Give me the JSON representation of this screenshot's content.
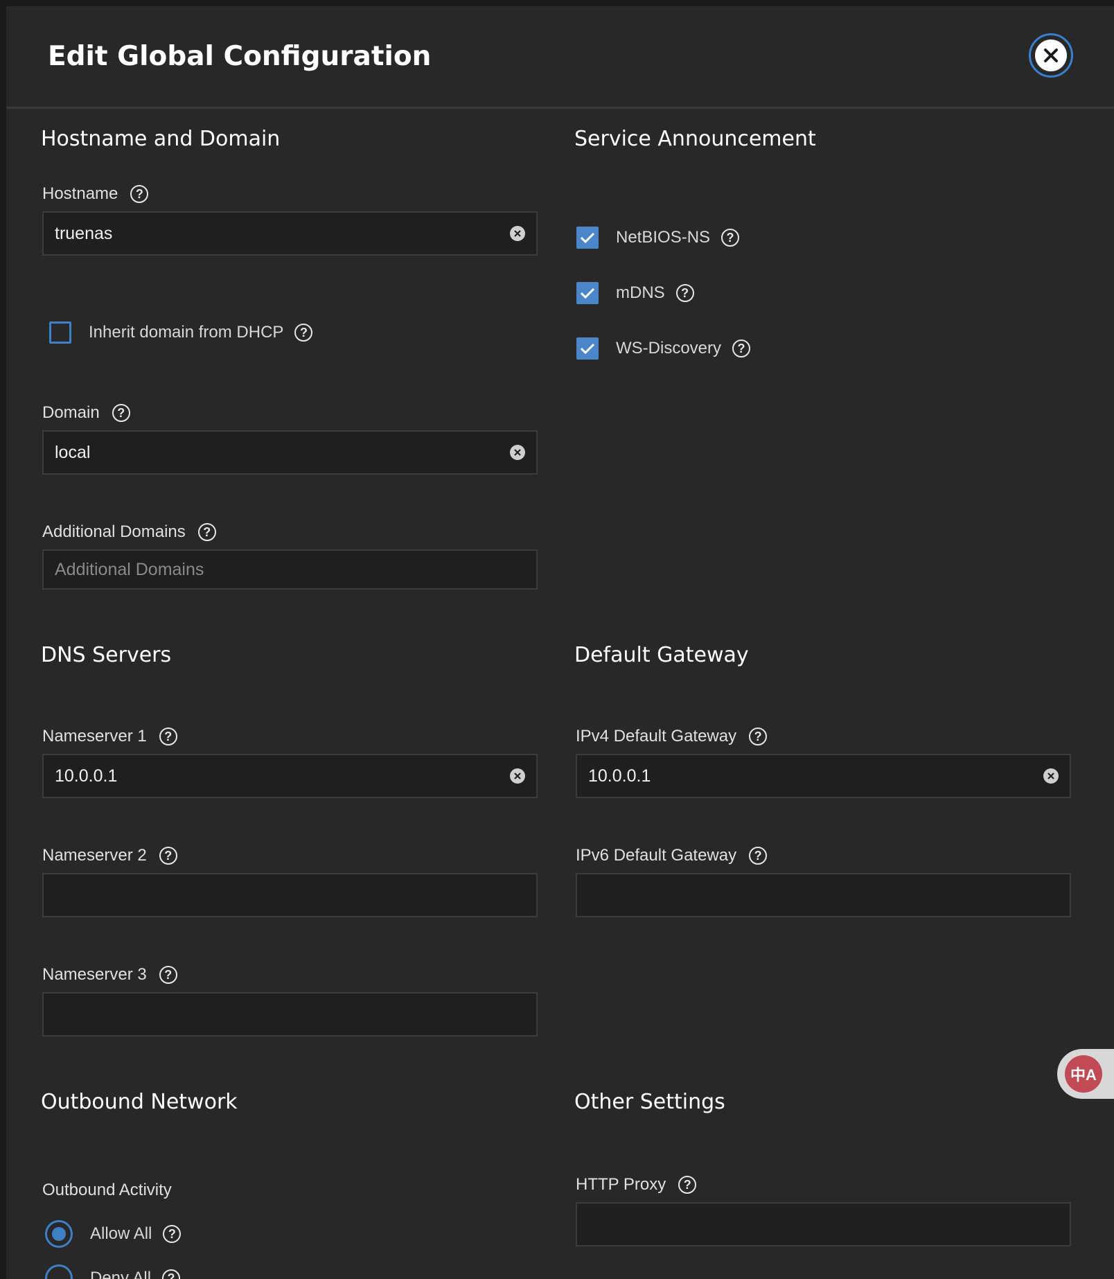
{
  "dialog": {
    "title": "Edit Global Configuration"
  },
  "hostname_domain": {
    "heading": "Hostname and Domain",
    "hostname_label": "Hostname",
    "hostname_value": "truenas",
    "inherit_label": "Inherit domain from DHCP",
    "inherit_checked": false,
    "domain_label": "Domain",
    "domain_value": "local",
    "additional_label": "Additional Domains",
    "additional_placeholder": "Additional Domains"
  },
  "service_announcement": {
    "heading": "Service Announcement",
    "items": [
      {
        "label": "NetBIOS-NS",
        "checked": true
      },
      {
        "label": "mDNS",
        "checked": true
      },
      {
        "label": "WS-Discovery",
        "checked": true
      }
    ]
  },
  "dns": {
    "heading": "DNS Servers",
    "ns1_label": "Nameserver 1",
    "ns1_value": "10.0.0.1",
    "ns2_label": "Nameserver 2",
    "ns2_value": "",
    "ns3_label": "Nameserver 3",
    "ns3_value": ""
  },
  "gateway": {
    "heading": "Default Gateway",
    "ipv4_label": "IPv4 Default Gateway",
    "ipv4_value": "10.0.0.1",
    "ipv6_label": "IPv6 Default Gateway",
    "ipv6_value": ""
  },
  "outbound": {
    "heading": "Outbound Network",
    "activity_label": "Outbound Activity",
    "options": [
      {
        "label": "Allow All",
        "selected": true
      },
      {
        "label": "Deny All",
        "selected": false
      }
    ]
  },
  "other": {
    "heading": "Other Settings",
    "proxy_label": "HTTP Proxy",
    "proxy_value": ""
  },
  "translate": {
    "glyph": "中A"
  },
  "colors": {
    "accent": "#3f7fc6",
    "panel_bg": "#282828",
    "input_bg": "#1f1f1f"
  }
}
